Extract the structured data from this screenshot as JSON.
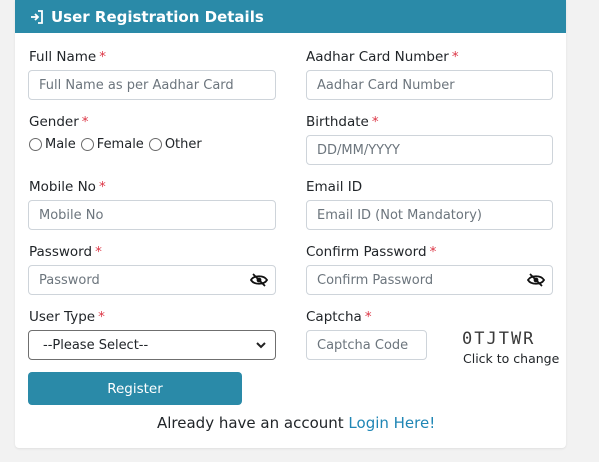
{
  "header": {
    "title": "User Registration Details",
    "icon": "sign-in-icon"
  },
  "required_mark": "*",
  "form": {
    "full_name": {
      "label": "Full Name",
      "placeholder": "Full Name as per Aadhar Card"
    },
    "aadhar": {
      "label": "Aadhar Card Number",
      "placeholder": "Aadhar Card Number"
    },
    "gender": {
      "label": "Gender",
      "options": [
        "Male",
        "Female",
        "Other"
      ]
    },
    "birthdate": {
      "label": "Birthdate",
      "placeholder": "DD/MM/YYYY"
    },
    "mobile": {
      "label": "Mobile No",
      "placeholder": "Mobile No"
    },
    "email": {
      "label": "Email ID",
      "placeholder": "Email ID (Not Mandatory)"
    },
    "password": {
      "label": "Password",
      "placeholder": "Password"
    },
    "confirm_password": {
      "label": "Confirm Password",
      "placeholder": "Confirm Password"
    },
    "user_type": {
      "label": "User Type",
      "selected": "--Please Select--"
    },
    "captcha": {
      "label": "Captcha",
      "placeholder": "Captcha Code",
      "code": "0TJTWR",
      "change_text": "Click to change"
    },
    "register_button": "Register"
  },
  "footer": {
    "text": "Already have an account ",
    "link": "Login Here!"
  },
  "colors": {
    "primary": "#2a8aa8",
    "required": "#dc3545",
    "link": "#1f86b5"
  }
}
